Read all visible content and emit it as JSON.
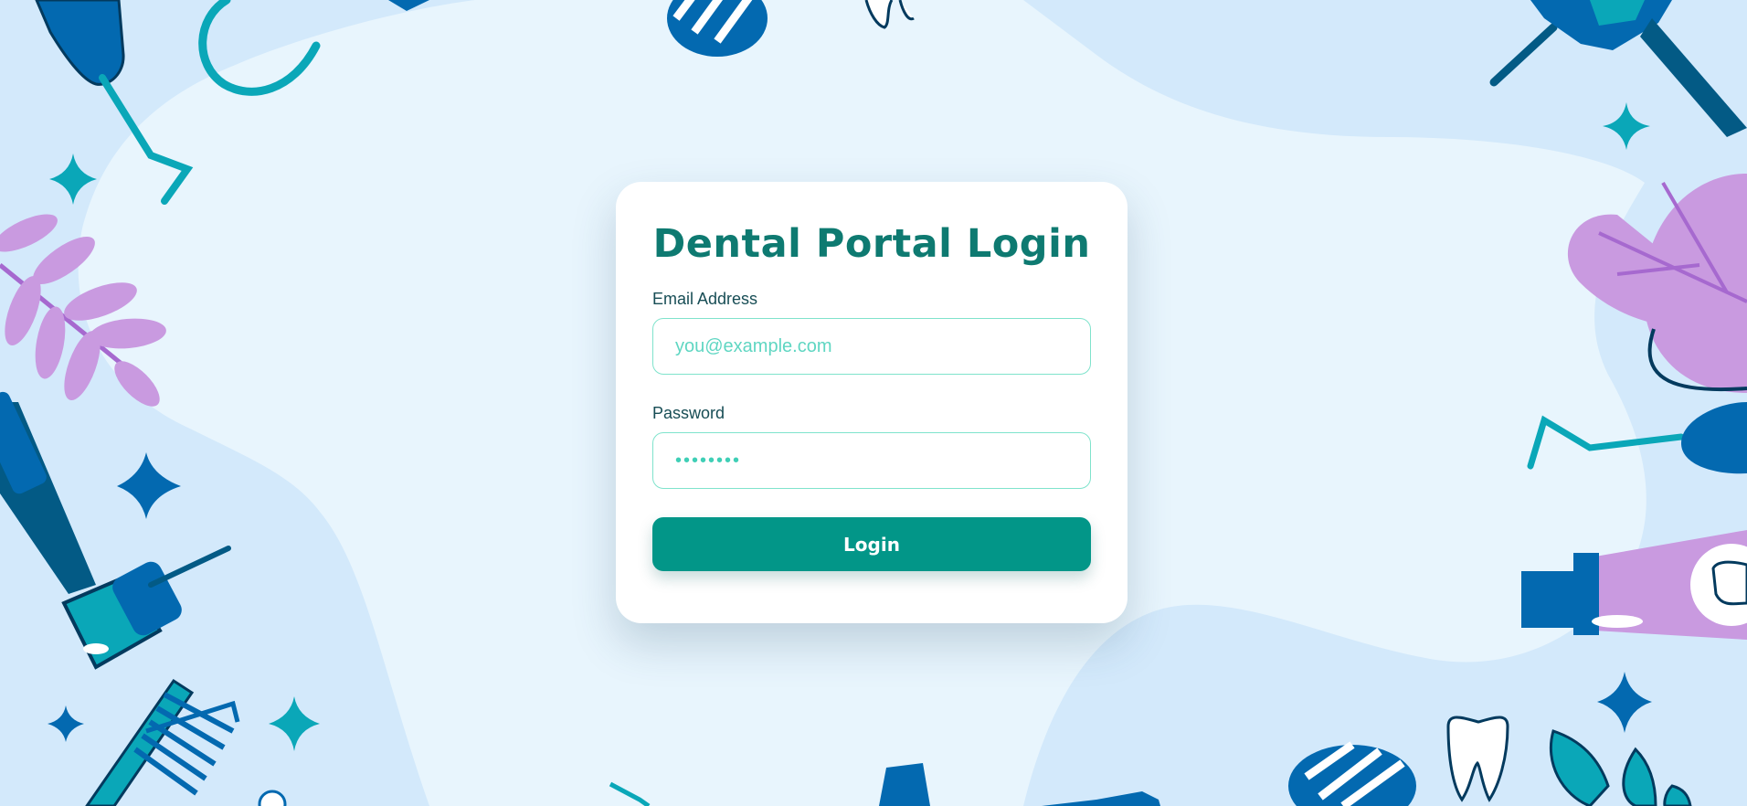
{
  "login": {
    "title": "Dental Portal Login",
    "email_label": "Email Address",
    "email_placeholder": "you@example.com",
    "password_label": "Password",
    "password_placeholder": "••••••••",
    "login_button": "Login"
  },
  "theme": {
    "background": "#e8f5fd",
    "accent": "#029688",
    "title_color": "#0e7a71",
    "input_border": "#7fe3cc",
    "illustration_blue": "#0369b0",
    "illustration_teal": "#0aa7b8",
    "illustration_purple": "#c99ae0"
  },
  "background": {
    "icons": [
      "dental-probe-icon",
      "dental-mirror-icon",
      "sparkle-icon",
      "leaf-branch-icon",
      "electric-toothbrush-icon",
      "toothbrush-icon",
      "dental-drill-icon",
      "tooth-icon",
      "toothpaste-tube-icon",
      "floss-icon",
      "leaf-icon",
      "plant-icon"
    ]
  }
}
